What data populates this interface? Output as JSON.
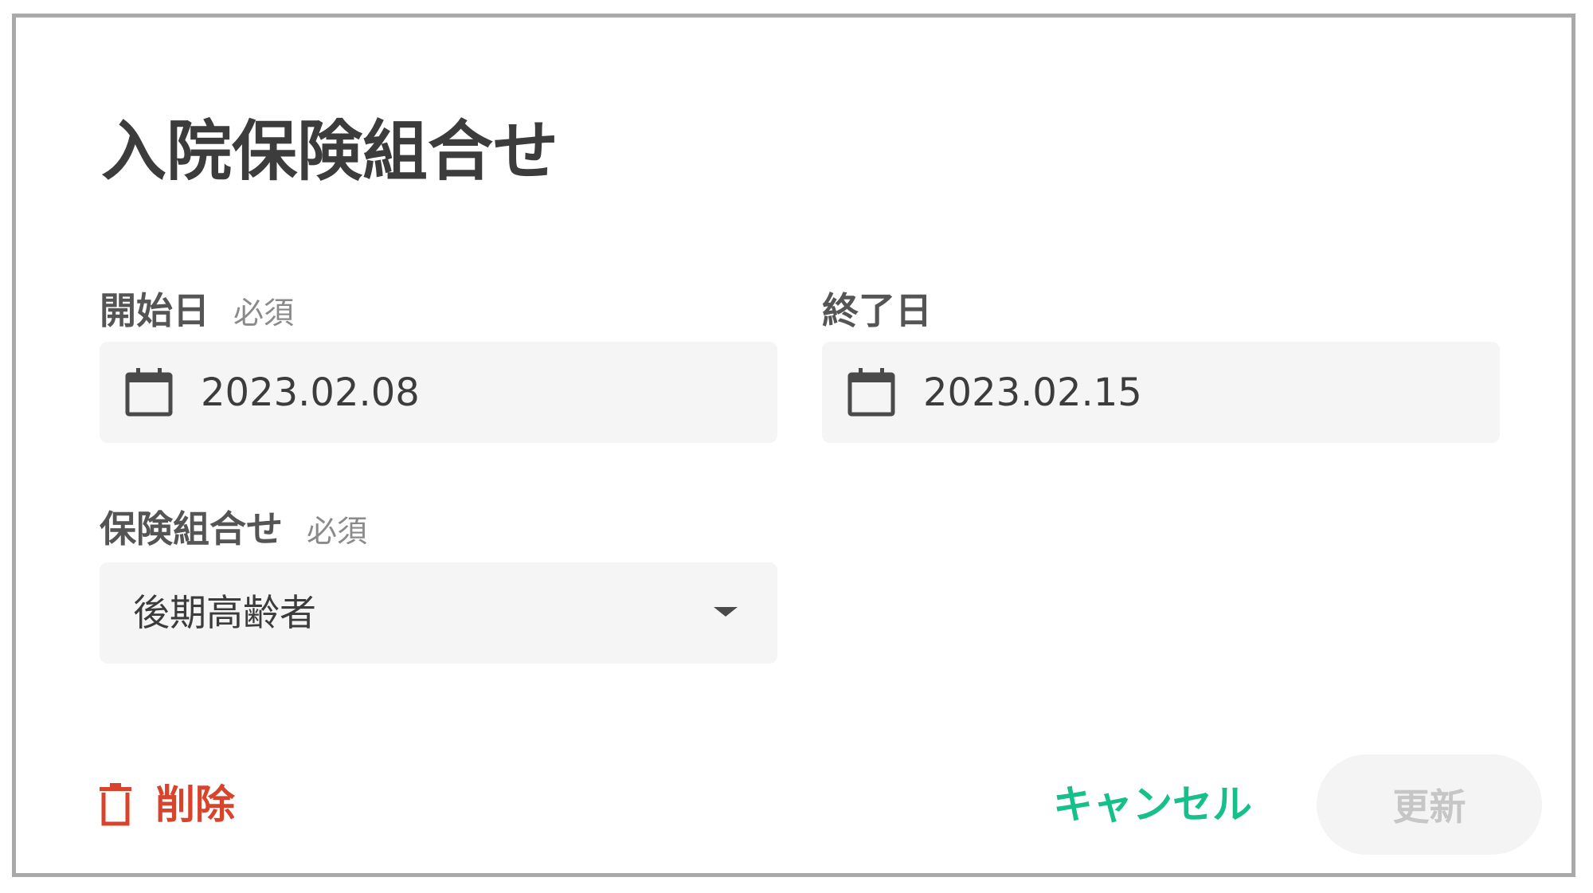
{
  "dialog": {
    "title": "入院保険組合せ"
  },
  "start_date": {
    "label": "開始日",
    "required": "必須",
    "value": "2023.02.08",
    "icon": "calendar-icon"
  },
  "end_date": {
    "label": "終了日",
    "value": "2023.02.15",
    "icon": "calendar-icon"
  },
  "insurance": {
    "label": "保険組合せ",
    "required": "必須",
    "selected": "後期高齢者",
    "icon": "caret-down-icon"
  },
  "actions": {
    "delete_label": "削除",
    "delete_icon": "trash-icon",
    "cancel_label": "キャンセル",
    "update_label": "更新"
  },
  "colors": {
    "delete": "#d9432b",
    "cancel": "#16c08a",
    "update_disabled_bg": "#f4f4f4",
    "update_disabled_text": "#c6c6c6",
    "field_bg": "#f5f5f5"
  }
}
